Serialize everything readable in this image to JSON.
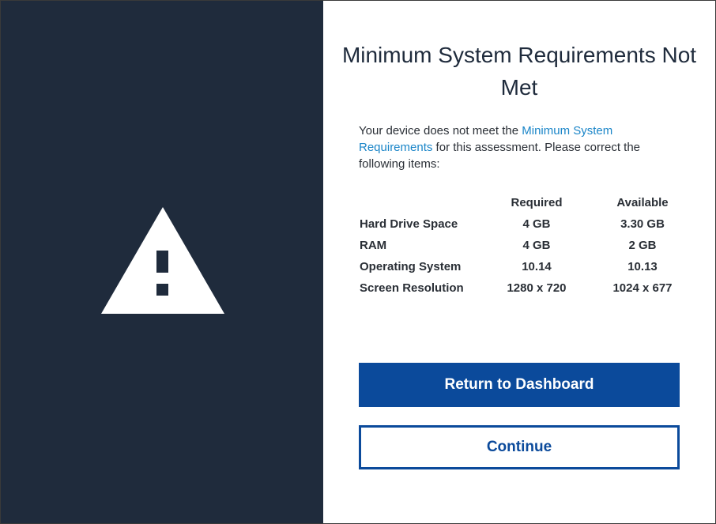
{
  "dialog": {
    "title": "Minimum System Requirements Not Met",
    "intro_prefix": "Your device does not meet the ",
    "intro_link": "Minimum System Requirements",
    "intro_suffix": " for this assessment.  Please correct the following items:",
    "icon": "warning-triangle-icon",
    "colors": {
      "left_panel": "#1f2b3c",
      "primary": "#0b4a9b",
      "link": "#1a85c8"
    }
  },
  "table": {
    "headers": [
      "",
      "Required",
      "Available"
    ],
    "rows": [
      [
        "Hard Drive Space",
        "4 GB",
        "3.30 GB"
      ],
      [
        "RAM",
        "4 GB",
        "2 GB"
      ],
      [
        "Operating System",
        "10.14",
        "10.13"
      ],
      [
        "Screen Resolution",
        "1280 x 720",
        "1024 x 677"
      ]
    ]
  },
  "buttons": {
    "return_label": "Return to Dashboard",
    "continue_label": "Continue"
  }
}
